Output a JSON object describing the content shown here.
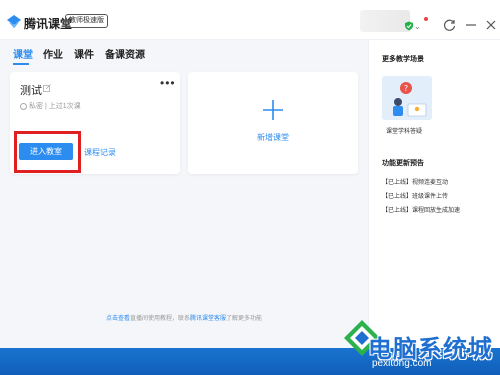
{
  "app": {
    "title": "腾讯课堂",
    "edition_badge": "教师极速版"
  },
  "tabs": [
    {
      "label": "课堂",
      "active": true
    },
    {
      "label": "作业",
      "active": false
    },
    {
      "label": "课件",
      "active": false
    },
    {
      "label": "备课资源",
      "active": false
    }
  ],
  "course_card": {
    "name": "测试",
    "meta": "私密 | 上过1次课",
    "enter_button": "进入教室",
    "record_link": "课程记录"
  },
  "add_card": {
    "label": "新增课堂"
  },
  "footer": {
    "link1": "点击查看",
    "text1": "直播间使用教程，联系",
    "link2": "腾讯课堂客服",
    "text2": "了解更多功能"
  },
  "sidebar": {
    "scenes_heading": "更多教学场景",
    "scene_label": "课堂学科答疑",
    "updates_heading": "功能更新预告",
    "updates": [
      "【已上线】视频连麦互动",
      "【已上线】班级课件上传",
      "【已上线】课程回放生成加速"
    ]
  },
  "watermark": {
    "text": "电脑系统城",
    "url": "pexitong.com"
  },
  "colors": {
    "accent": "#2d8cf0",
    "highlight": "#e02020",
    "taskbar": "#1a73d0"
  }
}
